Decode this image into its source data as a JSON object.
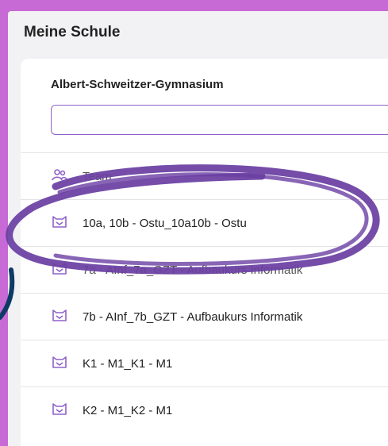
{
  "page": {
    "title": "Meine Schule"
  },
  "school": {
    "name": "Albert-Schweitzer-Gymnasium"
  },
  "search": {
    "value": "",
    "placeholder": ""
  },
  "rows": [
    {
      "label": "Team",
      "icon": "team-icon"
    },
    {
      "label": "10a, 10b - Ostu_10a10b - Ostu",
      "icon": "course-icon"
    },
    {
      "label": "7a - AInf_7a_GZT - Aufbaukurs Informatik",
      "icon": "course-icon"
    },
    {
      "label": "7b - AInf_7b_GZT - Aufbaukurs Informatik",
      "icon": "course-icon"
    },
    {
      "label": "K1 - M1_K1 - M1",
      "icon": "course-icon"
    },
    {
      "label": "K2 - M1_K2 - M1",
      "icon": "course-icon"
    }
  ],
  "colors": {
    "background": "#c86ad6",
    "accent": "#8e62c8",
    "annotation": "#6a3fa2",
    "arrow": "#0d3b66"
  }
}
